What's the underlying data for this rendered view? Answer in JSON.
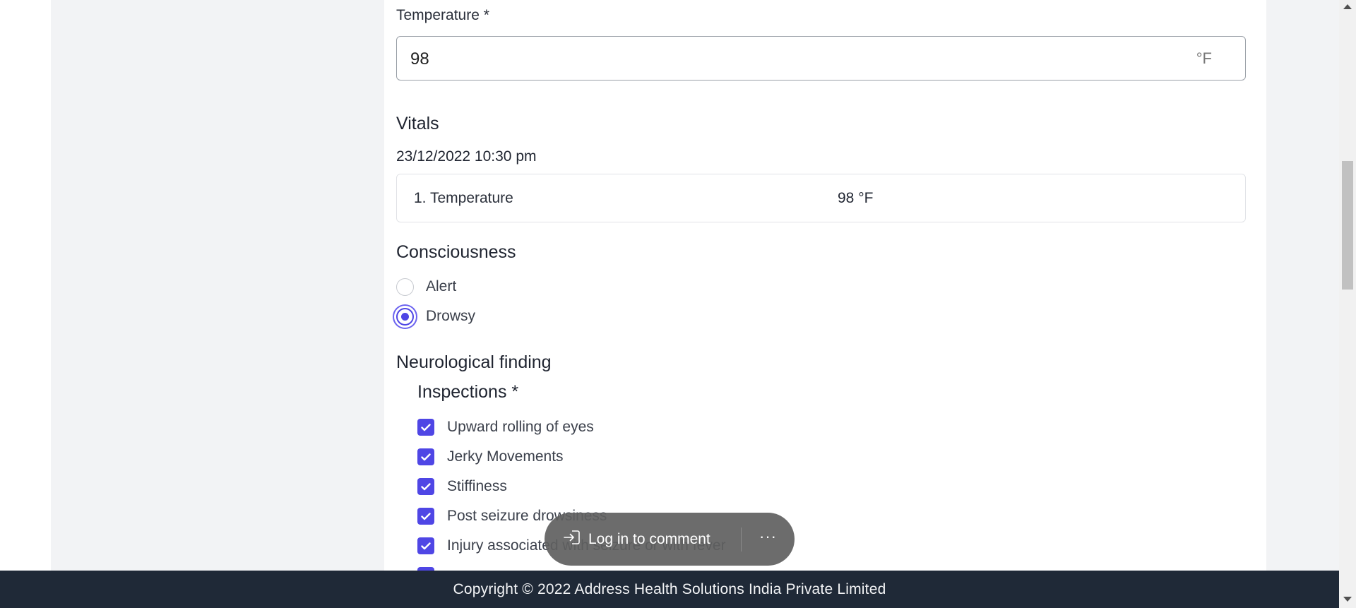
{
  "temperature_field": {
    "label": "Temperature *",
    "value": "98",
    "unit": "°F"
  },
  "vitals": {
    "title": "Vitals",
    "timestamp": "23/12/2022 10:30 pm",
    "rows": [
      {
        "name": "1. Temperature",
        "value": "98 °F"
      }
    ]
  },
  "consciousness": {
    "title": "Consciousness",
    "options": [
      {
        "label": "Alert",
        "checked": false
      },
      {
        "label": "Drowsy",
        "checked": true
      }
    ]
  },
  "neurological": {
    "title": "Neurological finding",
    "subtitle": "Inspections *",
    "items": [
      {
        "label": "Upward rolling of eyes",
        "checked": true
      },
      {
        "label": "Jerky Movements",
        "checked": true
      },
      {
        "label": "Stiffiness",
        "checked": true
      },
      {
        "label": "Post seizure drowsiness",
        "checked": true
      },
      {
        "label": "Injury associated with seizure or with fever",
        "checked": true
      }
    ]
  },
  "comment_bar": {
    "login_label": "Log in to comment",
    "more_label": "···"
  },
  "footer": {
    "copyright": "Copyright © 2022 Address Health Solutions India Private Limited"
  },
  "colors": {
    "accent": "#4f46e5",
    "footer_bg": "#1f2937",
    "gutter_bg": "#f2f3f5"
  }
}
